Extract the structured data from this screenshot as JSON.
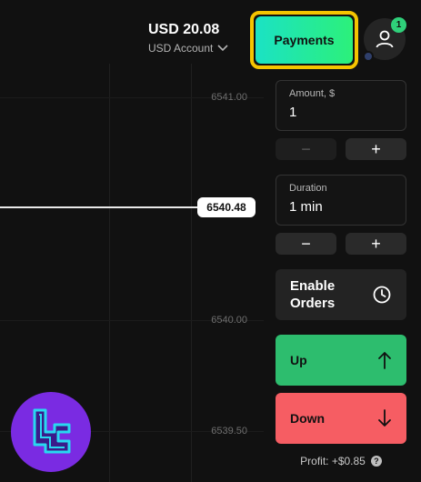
{
  "header": {
    "balance_amount": "USD 20.08",
    "account_label": "USD Account",
    "payments_label": "Payments",
    "notification_count": "1"
  },
  "chart": {
    "price_levels": [
      "6541.00",
      "6540.00",
      "6539.50"
    ],
    "current_price": "6540.48"
  },
  "trade_panel": {
    "amount": {
      "label": "Amount, $",
      "value": "1"
    },
    "duration": {
      "label": "Duration",
      "value": "1 min"
    },
    "minus_symbol": "−",
    "plus_symbol": "+",
    "enable_orders_label": "Enable Orders",
    "up_label": "Up",
    "down_label": "Down",
    "profit_text": "Profit: +$0.85",
    "help_symbol": "?"
  },
  "icons": {
    "chevron": "chevron-down-icon",
    "user": "user-icon",
    "clock": "clock-icon",
    "arrow_up": "arrow-up-icon",
    "arrow_down": "arrow-down-icon",
    "logo": "broker-logo-icon"
  },
  "colors": {
    "payments_gradient_start": "#1be2c4",
    "payments_gradient_end": "#2cf07a",
    "highlight_border": "#f5c400",
    "up_green": "#2dbd6e",
    "down_red": "#f65d63",
    "badge_green": "#2fd07a",
    "logo_purple": "#7a2be2"
  }
}
